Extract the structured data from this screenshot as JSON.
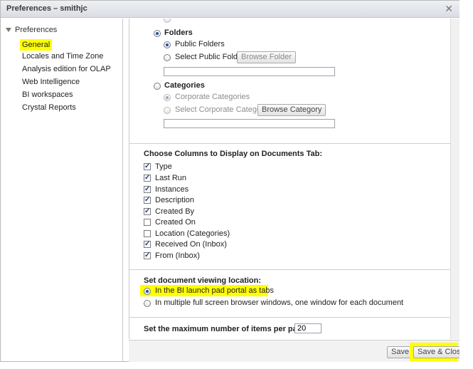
{
  "window": {
    "title": "Preferences – smithjc"
  },
  "sidebar": {
    "root": "Preferences",
    "items": [
      {
        "label": "General",
        "selected": true
      },
      {
        "label": "Locales and Time Zone"
      },
      {
        "label": "Analysis edition for OLAP"
      },
      {
        "label": "Web Intelligence"
      },
      {
        "label": "BI workspaces"
      },
      {
        "label": "Crystal Reports"
      }
    ]
  },
  "start_location": {
    "folders_label": "Folders",
    "public_folders_label": "Public Folders",
    "select_public_folder_label": "Select Public Folder:",
    "browse_folder_label": "Browse Folder",
    "categories_label": "Categories",
    "corporate_categories_label": "Corporate Categories",
    "select_corporate_category_label": "Select Corporate Category:",
    "browse_category_label": "Browse Category"
  },
  "columns": {
    "heading": "Choose Columns to Display on Documents Tab:",
    "items": [
      {
        "label": "Type",
        "checked": true
      },
      {
        "label": "Last Run",
        "checked": true
      },
      {
        "label": "Instances",
        "checked": true
      },
      {
        "label": "Description",
        "checked": true
      },
      {
        "label": "Created By",
        "checked": true
      },
      {
        "label": "Created On",
        "checked": false
      },
      {
        "label": "Location (Categories)",
        "checked": false
      },
      {
        "label": "Received On (Inbox)",
        "checked": true
      },
      {
        "label": "From (Inbox)",
        "checked": true
      }
    ]
  },
  "viewing": {
    "heading": "Set document viewing location:",
    "option_tabs": "In the BI launch pad portal as tabs",
    "option_windows": "In multiple full screen browser windows, one window for each document"
  },
  "max_items": {
    "label": "Set the maximum number of items per page:",
    "value": "20"
  },
  "footer": {
    "save_label": "Save",
    "save_close_label": "Save & Close"
  },
  "colors": {
    "highlight": "#ffff00",
    "selected_radio": "#1a4fb5"
  }
}
